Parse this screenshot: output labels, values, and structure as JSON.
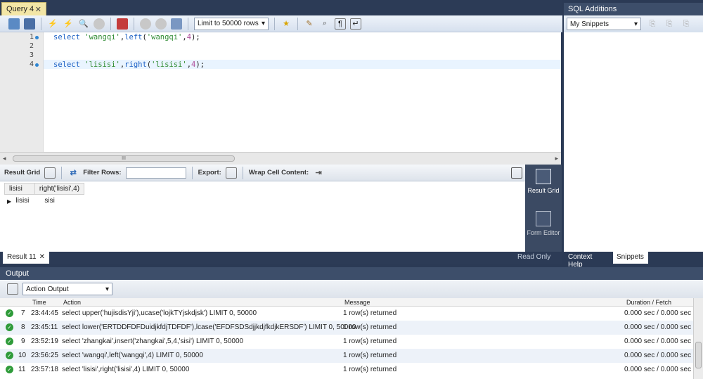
{
  "editor_tab": {
    "title": "Query 4",
    "close": "✕"
  },
  "toolbar": {
    "limit": "Limit to 50000 rows"
  },
  "editor": {
    "lines": [
      {
        "num": "1",
        "kw1": "select ",
        "s1": "'wangqi'",
        "p1": ",",
        "fn": "left",
        "p2": "(",
        "s2": "'wangqi'",
        "p3": ",",
        "n": "4",
        "p4": ");"
      },
      {
        "num": "2"
      },
      {
        "num": "3"
      },
      {
        "num": "4",
        "kw1": "select ",
        "s1": "'lisisi'",
        "p1": ",",
        "fn": "right",
        "p2": "(",
        "s2": "'lisisi'",
        "p3": ",",
        "n": "4",
        "p4": ");"
      }
    ],
    "scroll_thumb": "III"
  },
  "result_toolbar": {
    "result_grid": "Result Grid",
    "filter_rows": "Filter Rows:",
    "export": "Export:",
    "wrap": "Wrap Cell Content:"
  },
  "grid": {
    "columns": [
      "lisisi",
      "right('lisisi',4)"
    ],
    "rows": [
      [
        "lisisi",
        "sisi"
      ]
    ]
  },
  "side_tabs": {
    "result_grid": "Result Grid",
    "form_editor": "Form Editor"
  },
  "result_tab": {
    "title": "Result 11",
    "close": "✕",
    "read_only": "Read Only"
  },
  "sql_additions": {
    "title": "SQL Additions",
    "snippets_select": "My Snippets",
    "context_help": "Context Help",
    "snippets": "Snippets"
  },
  "output": {
    "title": "Output",
    "selector": "Action Output",
    "columns": {
      "time": "Time",
      "action": "Action",
      "message": "Message",
      "duration": "Duration / Fetch"
    },
    "rows": [
      {
        "n": "7",
        "time": "23:44:45",
        "action": "select upper('hujisdisYji'),ucase('lojkTYjskdjsk') LIMIT 0, 50000",
        "message": "1 row(s) returned",
        "duration": "0.000 sec / 0.000 sec"
      },
      {
        "n": "8",
        "time": "23:45:11",
        "action": "select lower('ERTDDFDFDuidjkfdjTDFDF'),lcase('EFDFSDSdjjkdjfkdjkERSDF') LIMIT 0, 50000",
        "message": "1 row(s) returned",
        "duration": "0.000 sec / 0.000 sec"
      },
      {
        "n": "9",
        "time": "23:52:19",
        "action": "select 'zhangkai',insert('zhangkai',5,4,'sisi') LIMIT 0, 50000",
        "message": "1 row(s) returned",
        "duration": "0.000 sec / 0.000 sec"
      },
      {
        "n": "10",
        "time": "23:56:25",
        "action": "select 'wangqi',left('wangqi',4) LIMIT 0, 50000",
        "message": "1 row(s) returned",
        "duration": "0.000 sec / 0.000 sec"
      },
      {
        "n": "11",
        "time": "23:57:18",
        "action": "select 'lisisi',right('lisisi',4) LIMIT 0, 50000",
        "message": "1 row(s) returned",
        "duration": "0.000 sec / 0.000 sec"
      }
    ]
  },
  "colors": {
    "frame": "#2c3b56",
    "tab": "#f3e6a6",
    "ok": "#2f9b3a",
    "keyword": "#1a5fc4",
    "string": "#2f8b33",
    "number": "#ae4d9a"
  }
}
